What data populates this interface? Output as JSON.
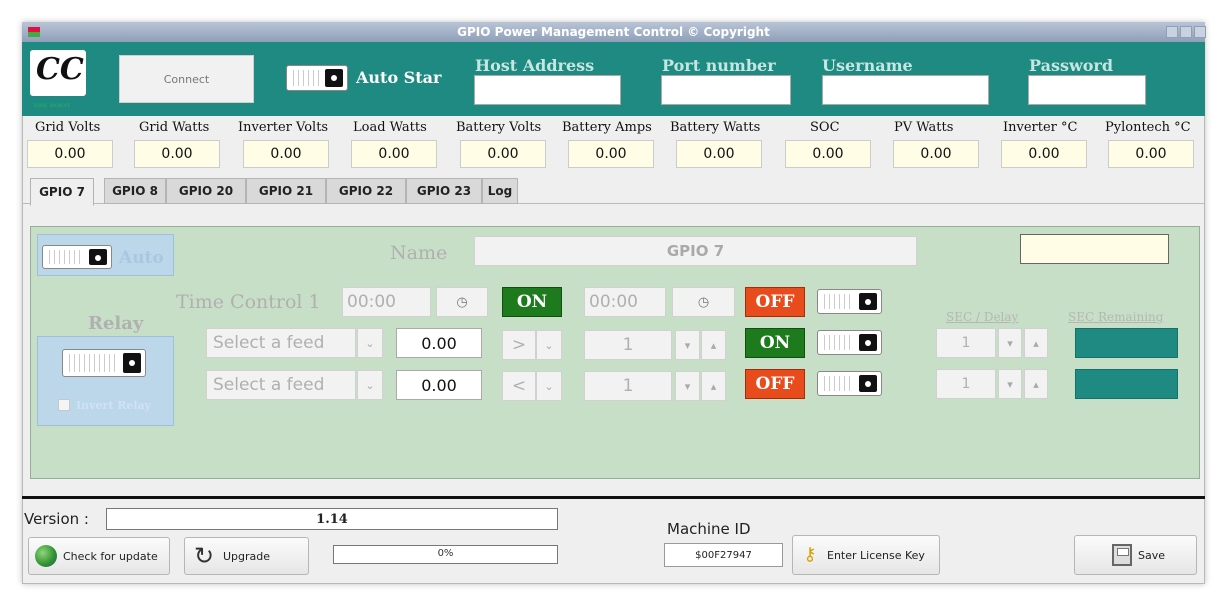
{
  "window": {
    "title": "GPIO Power Management Control    © Copyright"
  },
  "header": {
    "logo_text": "CC",
    "connect_label": "Connect",
    "autostart_label": "Auto Star",
    "host_label": "Host Address",
    "port_label": "Port number",
    "username_label": "Username",
    "password_label": "Password",
    "host_value": "",
    "port_value": "",
    "username_value": "",
    "password_value": ""
  },
  "metrics": [
    {
      "label": "Grid Volts",
      "value": "0.00"
    },
    {
      "label": "Grid Watts",
      "value": "0.00"
    },
    {
      "label": "Inverter Volts",
      "value": "0.00"
    },
    {
      "label": "Load Watts",
      "value": "0.00"
    },
    {
      "label": "Battery Volts",
      "value": "0.00"
    },
    {
      "label": "Battery Amps",
      "value": "0.00"
    },
    {
      "label": "Battery Watts",
      "value": "0.00"
    },
    {
      "label": "SOC",
      "value": "0.00"
    },
    {
      "label": "PV Watts",
      "value": "0.00"
    },
    {
      "label": "Inverter °C",
      "value": "0.00"
    },
    {
      "label": "Pylontech °C",
      "value": "0.00"
    }
  ],
  "tabs": [
    "GPIO 7",
    "GPIO 8",
    "GPIO 20",
    "GPIO 21",
    "GPIO 22",
    "GPIO 23",
    "Log"
  ],
  "panel": {
    "auto_label": "Auto",
    "name_label": "Name",
    "name_value": "GPIO 7",
    "top_right_value": "",
    "relay_label": "Relay",
    "invert_relay_label": "Invert Relay",
    "time_control_label": "Time Control 1",
    "time_on_value": "00:00",
    "time_off_value": "00:00",
    "on_label": "ON",
    "off_label": "OFF",
    "sec_delay_label": "SEC / Delay",
    "sec_remaining_label": "SEC Remaining",
    "rows": [
      {
        "feed_placeholder": "Select a feed",
        "value": "0.00",
        "operator": ">",
        "count": "1",
        "state": "ON",
        "sec": "1"
      },
      {
        "feed_placeholder": "Select a feed",
        "value": "0.00",
        "operator": "<",
        "count": "1",
        "state": "OFF",
        "sec": "1"
      }
    ]
  },
  "footer": {
    "version_label": "Version :",
    "version_value": "1.14",
    "check_update_label": "Check for update",
    "upgrade_label": "Upgrade",
    "progress_text": "0%",
    "progress_fraction": 0,
    "machine_id_label": "Machine ID",
    "machine_id_value": "$00F27947",
    "license_label": "Enter License Key",
    "save_label": "Save"
  }
}
